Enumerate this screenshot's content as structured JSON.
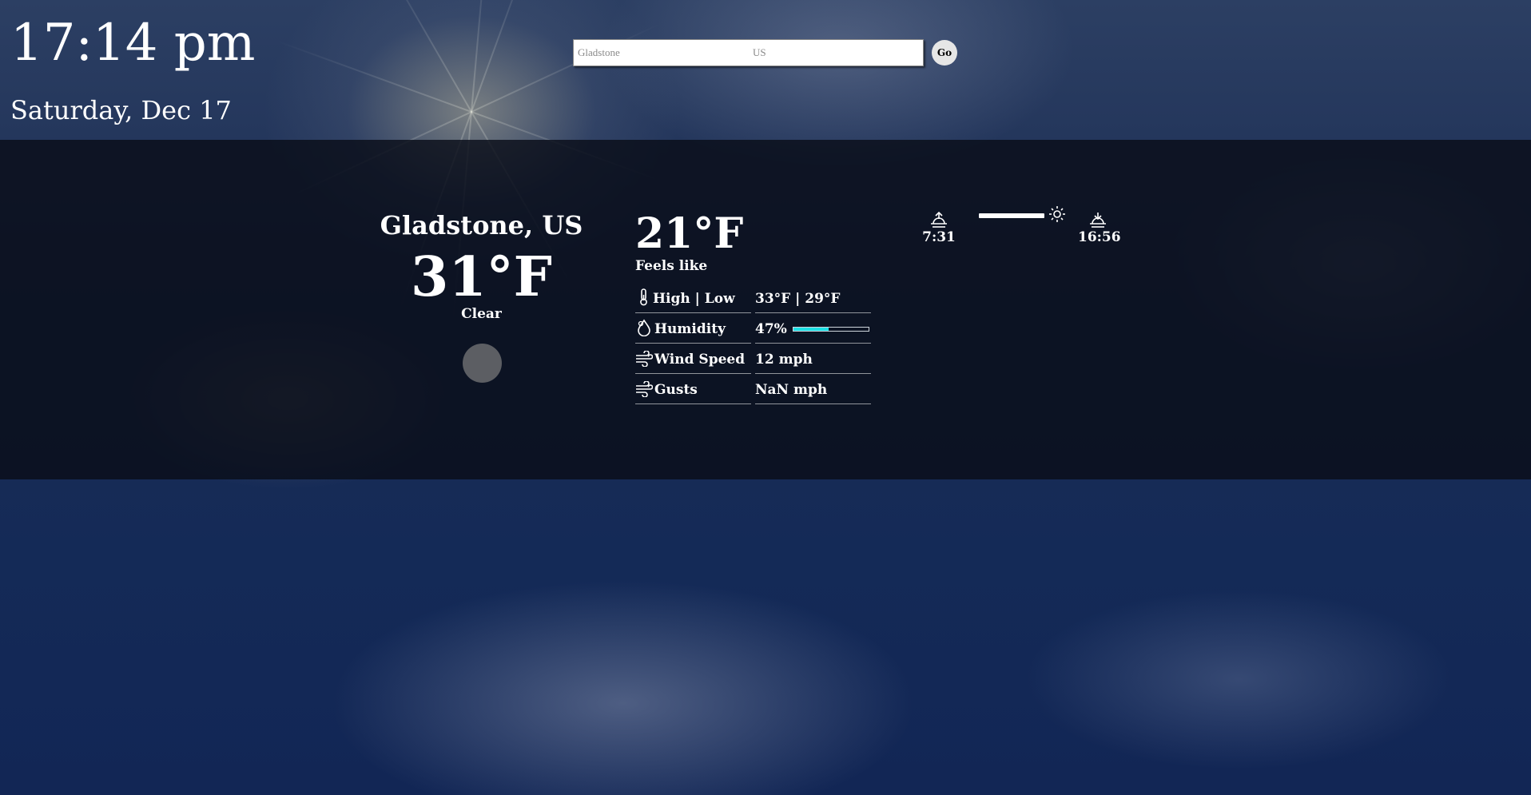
{
  "clock": {
    "time": "17:14 pm",
    "date": "Saturday, Dec 17"
  },
  "search": {
    "city_placeholder": "Gladstone",
    "country_placeholder": "US",
    "go_label": "Go"
  },
  "current": {
    "location": "Gladstone, US",
    "temperature": "31°F",
    "condition": "Clear",
    "condition_icon": "weather-icon-placeholder"
  },
  "details": {
    "feels_like_value": "21°F",
    "feels_like_label": "Feels like",
    "rows": [
      {
        "icon": "thermometer-icon",
        "label": "High | Low",
        "value": "33°F | 29°F"
      },
      {
        "icon": "droplet-icon",
        "label": "Humidity",
        "value": "47%",
        "humidity_fraction": 0.47
      },
      {
        "icon": "wind-icon",
        "label": "Wind Speed",
        "value": "12 mph"
      },
      {
        "icon": "wind-icon",
        "label": "Gusts",
        "value": "NaN mph"
      }
    ]
  },
  "sun": {
    "sunrise": "7:31",
    "sunset": "16:56",
    "day_progress_fraction": 0.78,
    "sunrise_icon": "sunrise-icon",
    "sunset_icon": "sunset-icon",
    "marker_icon": "sun-icon"
  },
  "colors": {
    "humidity_bar": "#1de0e6",
    "panel": "#0a0e18"
  }
}
